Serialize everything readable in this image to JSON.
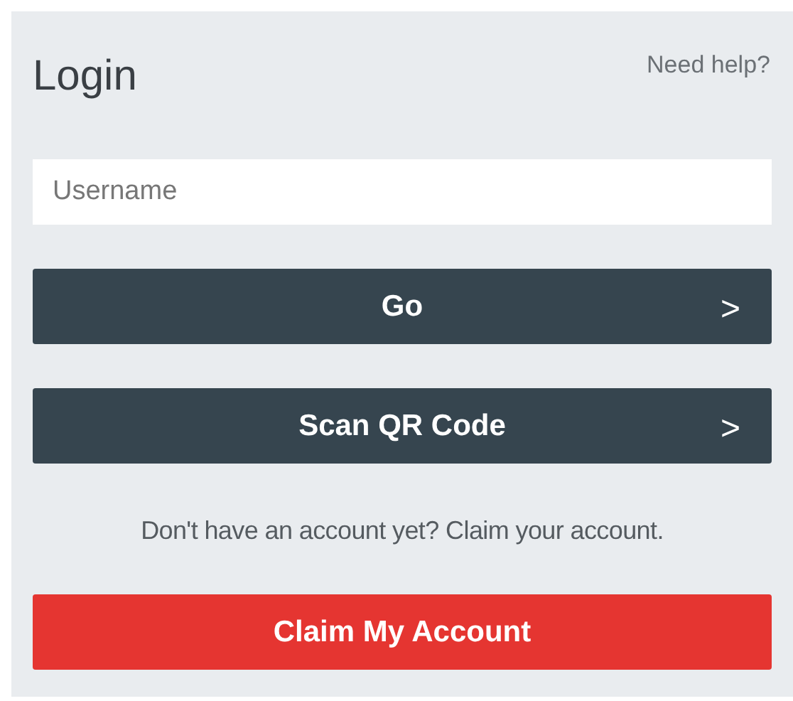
{
  "title": "Login",
  "help_link": "Need help?",
  "username": {
    "placeholder": "Username"
  },
  "buttons": [
    {
      "label": "Go",
      "chevron": ">"
    },
    {
      "label": "Scan QR Code",
      "chevron": ">"
    }
  ],
  "claim_text": "Don't have an account yet? Claim your account.",
  "claim_button": "Claim My Account"
}
